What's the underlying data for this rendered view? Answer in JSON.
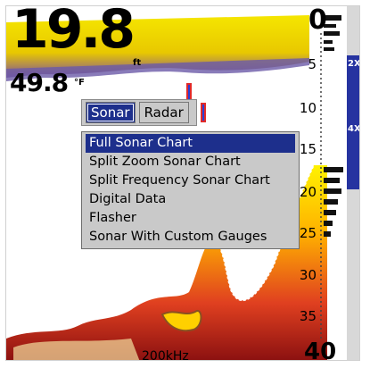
{
  "readout": {
    "depth_value": "19.8",
    "depth_unit": "ft",
    "temperature_value": "49.8",
    "temperature_unit": "°F"
  },
  "depth_scale": {
    "labels": [
      "0",
      "5",
      "10",
      "15",
      "20",
      "25",
      "30",
      "35",
      "40"
    ]
  },
  "frequency": "200kHz",
  "zoom_bar": {
    "upper_label": "2X",
    "lower_label": "4X"
  },
  "menu": {
    "tabs": [
      "Sonar",
      "Radar"
    ],
    "active_tab": "Sonar",
    "items": [
      "Full Sonar Chart",
      "Split Zoom Sonar Chart",
      "Split Frequency Sonar Chart",
      "Digital Data",
      "Flasher",
      "Sonar With Custom Gauges"
    ],
    "selected_item": "Full Sonar Chart"
  },
  "colors": {
    "surface_clutter": "#f5e600",
    "highlight": "#1d2f8c",
    "strong_return": "#d31a1a",
    "weak_return": "#2a3fd4"
  }
}
